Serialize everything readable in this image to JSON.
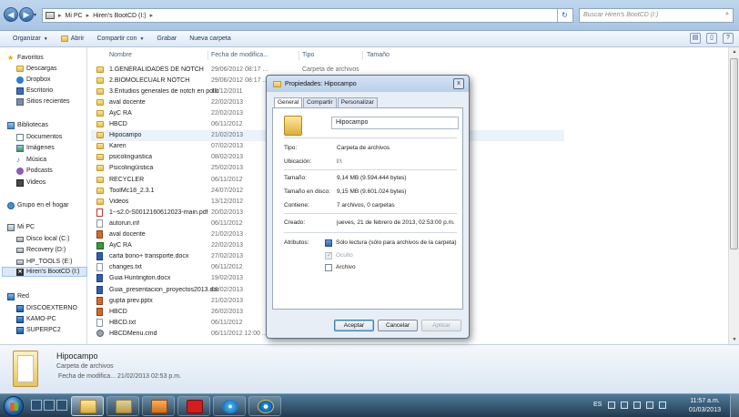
{
  "addressbar": {
    "path": [
      "Mi PC",
      "Hiren's BootCD (I:)"
    ],
    "search_placeholder": "Buscar Hiren's BootCD (I:)"
  },
  "toolbar": {
    "organize": "Organizar",
    "open": "Abrir",
    "share": "Compartir con",
    "burn": "Grabar",
    "new_folder": "Nueva carpeta"
  },
  "navpane": {
    "favorites": "Favoritos",
    "fav_items": [
      "Descargas",
      "Dropbox",
      "Escritorio",
      "Sitios recientes"
    ],
    "libraries": "Bibliotecas",
    "lib_items": [
      "Documentos",
      "Imágenes",
      "Música",
      "Podcasts",
      "Videos"
    ],
    "homegroup": "Grupo en el hogar",
    "computer": "Mi PC",
    "drives": [
      "Disco local (C:)",
      "Recovery (D:)",
      "HP_TOOLS (E:)",
      "Hiren's BootCD (I:)"
    ],
    "network": "Red",
    "net_items": [
      "DISCOEXTERNO",
      "KAMO-PC",
      "SUPERPC2"
    ]
  },
  "columns": {
    "name": "Nombre",
    "date": "Fecha de modifica...",
    "type": "Tipo",
    "size": "Tamaño"
  },
  "files": [
    {
      "name": "1.GENERALIDADES DE NOTCH",
      "date": "29/06/2012 08:17 ...",
      "type": "Carpeta de archivos",
      "size": ""
    },
    {
      "name": "2.BIOMOLECUALR NOTCH",
      "date": "29/06/2012 08:17 ...",
      "type": "Carpeta de archivos",
      "size": ""
    },
    {
      "name": "3.Entudios generales de notch en pollo",
      "date": "15/12/2011",
      "type": "",
      "size": ""
    },
    {
      "name": "aval docente",
      "date": "22/02/2013",
      "type": "",
      "size": ""
    },
    {
      "name": "AyC RA",
      "date": "22/02/2013",
      "type": "",
      "size": ""
    },
    {
      "name": "HBCD",
      "date": "06/11/2012",
      "type": "",
      "size": ""
    },
    {
      "name": "Hipocampo",
      "date": "21/02/2013",
      "type": "",
      "size": ""
    },
    {
      "name": "Karen",
      "date": "07/02/2013",
      "type": "",
      "size": ""
    },
    {
      "name": "psicolinguistica",
      "date": "08/02/2013",
      "type": "",
      "size": ""
    },
    {
      "name": "Psicolingüística",
      "date": "25/02/2013",
      "type": "",
      "size": ""
    },
    {
      "name": "RECYCLER",
      "date": "06/11/2012",
      "type": "",
      "size": ""
    },
    {
      "name": "ToolMc18_2.3.1",
      "date": "24/07/2012",
      "type": "",
      "size": ""
    },
    {
      "name": "Videos",
      "date": "13/12/2012",
      "type": "",
      "size": ""
    },
    {
      "name": "1--s2.0-S0012160612023-main.pdf",
      "date": "20/02/2013",
      "type": "",
      "size": ""
    },
    {
      "name": "autorun.inf",
      "date": "06/11/2012",
      "type": "",
      "size": ""
    },
    {
      "name": "aval docente",
      "date": "21/02/2013",
      "type": "",
      "size": ""
    },
    {
      "name": "AyC RA",
      "date": "22/02/2013",
      "type": "",
      "size": ""
    },
    {
      "name": "carta bono+ transporte.docx",
      "date": "27/02/2013",
      "type": "",
      "size": ""
    },
    {
      "name": "changes.txt",
      "date": "06/11/2012",
      "type": "",
      "size": ""
    },
    {
      "name": "Guia Huntington.docx",
      "date": "19/02/2013",
      "type": "",
      "size": ""
    },
    {
      "name": "Guia_presentacion_proyectos2013.doc",
      "date": "06/02/2013",
      "type": "",
      "size": ""
    },
    {
      "name": "gupta prev.pptx",
      "date": "21/02/2013",
      "type": "",
      "size": ""
    },
    {
      "name": "HBCD",
      "date": "26/02/2013",
      "type": "",
      "size": ""
    },
    {
      "name": "HBCD.txt",
      "date": "06/11/2012",
      "type": "",
      "size": ""
    },
    {
      "name": "HBCDMenu.cmd",
      "date": "06/11/2012 12:00 ...",
      "type": "Script de comand...",
      "size": "1 KB"
    }
  ],
  "details": {
    "name": "Hipocampo",
    "type": "Carpeta de archivos",
    "modified": "Fecha de modifica... 21/02/2013 02:53 p.m."
  },
  "dialog": {
    "title": "Propiedades: Hipocampo",
    "close": "x",
    "tabs": [
      "General",
      "Compartir",
      "Personalizar"
    ],
    "folder_name": "Hipocampo",
    "rows": [
      {
        "label": "Tipo:",
        "value": "Carpeta de archivos"
      },
      {
        "label": "Ubicación:",
        "value": "I:\\"
      },
      {
        "label": "Tamaño:",
        "value": "9,14 MB (9.594.444 bytes)"
      },
      {
        "label": "Tamaño en disco:",
        "value": "9,15 MB (9.601.024 bytes)"
      },
      {
        "label": "Contiene:",
        "value": "7 archivos, 0 carpetas"
      },
      {
        "label": "Creado:",
        "value": "jueves, 21 de febrero de 2013, 02:53:00 p.m."
      }
    ],
    "attributes_label": "Atributos:",
    "attributes": [
      {
        "label": "Sólo lectura (sólo para archivos de la carpeta)",
        "state": "indeterminate"
      },
      {
        "label": "Oculto",
        "state": "disabled"
      },
      {
        "label": "Archivo",
        "state": "unchecked"
      }
    ],
    "buttons": {
      "ok": "Aceptar",
      "cancel": "Cancelar",
      "apply": "Aplicar"
    }
  },
  "taskbar": {
    "language": "ES",
    "time": "11:57 a.m.",
    "date": "01/03/2013"
  }
}
